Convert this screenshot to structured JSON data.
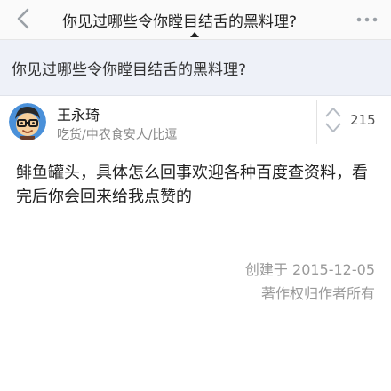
{
  "nav": {
    "title": "你见过哪些令你瞠目结舌的黑料理?",
    "back_icon": "chevron-left-icon",
    "more_icon": "more-horizontal-icon"
  },
  "question": {
    "title": "你见过哪些令你瞠目结舌的黑料理?"
  },
  "author": {
    "name": "王永琦",
    "bio": "吃货/中农食安人/比逗",
    "avatar_icon": "avatar-cartoon-glasses"
  },
  "vote": {
    "count": "215",
    "icon": "vote-arrows-icon"
  },
  "answer": {
    "text": "鲱鱼罐头，具体怎么回事欢迎各种百度查资料，看完后你会回来给我点赞的",
    "created": "创建于 2015-12-05",
    "copyright": "著作权归作者所有"
  },
  "colors": {
    "nav_bg": "#fafafa",
    "question_band_bg": "#eef1f8",
    "muted_text": "#999999",
    "icon_gray": "#9aa0a6"
  }
}
